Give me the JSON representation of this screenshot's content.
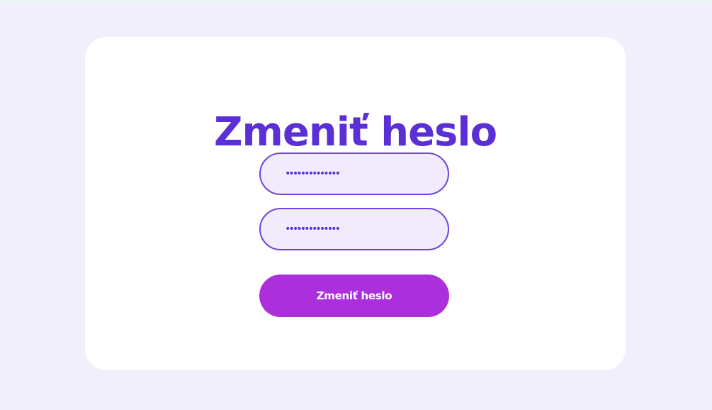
{
  "page": {
    "title": "Zmeniť heslo"
  },
  "form": {
    "password_value": "••••••••••••••",
    "confirm_password_value": "••••••••••••••",
    "submit_label": "Zmeniť heslo"
  },
  "colors": {
    "page_background": "#f2effd",
    "card_background": "#ffffff",
    "title": "#5a2fd6",
    "field_border": "#7044dc",
    "field_background": "#f1ecfb",
    "button_background": "#ac2fdc",
    "button_text": "#ffffff"
  }
}
